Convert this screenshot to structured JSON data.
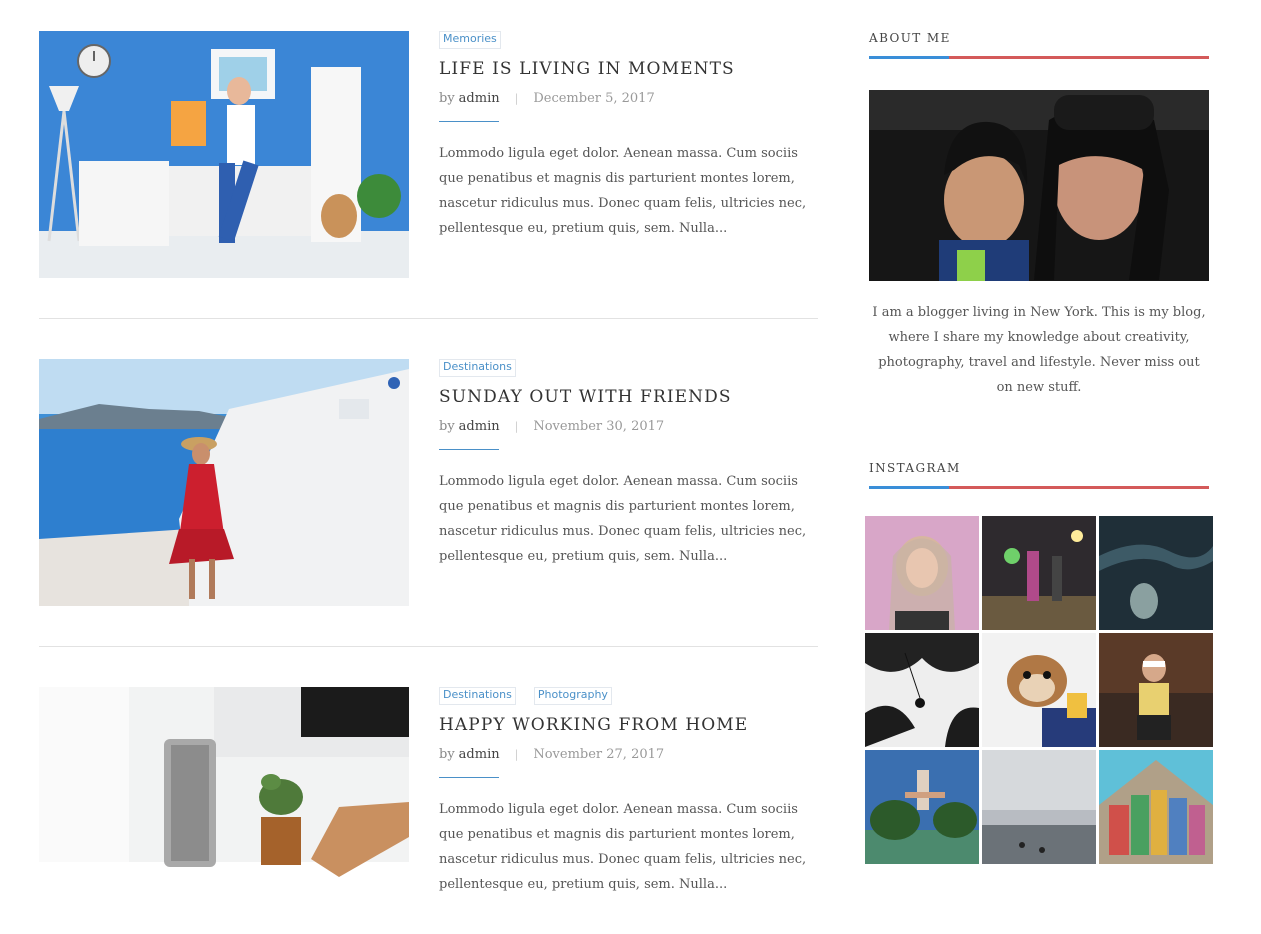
{
  "posts": [
    {
      "categories": [
        "Memories"
      ],
      "title": "LIFE IS LIVING IN MOMENTS",
      "by": "by",
      "author": "admin",
      "separator": "|",
      "date": "December 5, 2017",
      "excerpt": "Lommodo ligula eget dolor. Aenean massa. Cum sociis que penatibus et magnis dis parturient montes lorem, nascetur ridiculus mus. Donec quam felis, ultricies nec, pellentesque eu, pretium quis, sem. Nulla..."
    },
    {
      "categories": [
        "Destinations"
      ],
      "title": "SUNDAY OUT WITH FRIENDS",
      "by": "by",
      "author": "admin",
      "separator": "|",
      "date": "November 30, 2017",
      "excerpt": "Lommodo ligula eget dolor. Aenean massa. Cum sociis que penatibus et magnis dis parturient montes lorem, nascetur ridiculus mus. Donec quam felis, ultricies nec, pellentesque eu, pretium quis, sem. Nulla..."
    },
    {
      "categories": [
        "Destinations",
        "Photography"
      ],
      "title": "HAPPY WORKING FROM HOME",
      "by": "by",
      "author": "admin",
      "separator": "|",
      "date": "November 27, 2017",
      "excerpt": "Lommodo ligula eget dolor. Aenean massa. Cum sociis que penatibus et magnis dis parturient montes lorem, nascetur ridiculus mus. Donec quam felis, ultricies nec, pellentesque eu, pretium quis, sem. Nulla..."
    }
  ],
  "sidebar": {
    "about": {
      "title": "ABOUT ME",
      "text": "I am a blogger living in New York. This is my blog, where I share my knowledge about creativity, photography, travel and lifestyle. Never miss out on new stuff."
    },
    "instagram": {
      "title": "INSTAGRAM"
    }
  },
  "colors": {
    "accent_blue": "#3a8ed8",
    "accent_red": "#d45a5a",
    "category_text": "#4a90c8"
  }
}
